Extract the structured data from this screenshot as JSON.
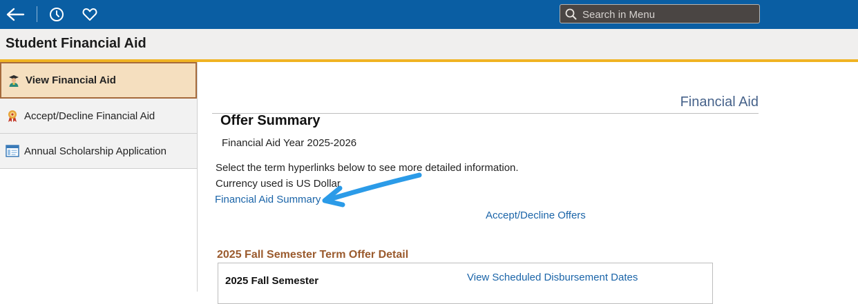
{
  "header": {
    "back_icon": "back-arrow-icon",
    "history_icon": "history-icon",
    "favorites_icon": "heart-icon",
    "search_placeholder": "Search in Menu",
    "search_icon": "search-icon"
  },
  "page_title": "Student Financial Aid",
  "sidebar": {
    "items": [
      {
        "label": "View Financial Aid",
        "icon": "student-graduate-icon",
        "active": true
      },
      {
        "label": "Accept/Decline Financial Aid",
        "icon": "award-ribbon-icon",
        "active": false
      },
      {
        "label": "Annual Scholarship Application",
        "icon": "application-window-icon",
        "active": false
      }
    ]
  },
  "main": {
    "section_title": "Financial Aid",
    "offer_summary_heading": "Offer Summary",
    "aid_year": "Financial Aid Year 2025-2026",
    "instruction": "Select the term hyperlinks below to see more detailed information.",
    "currency": "Currency used is US Dollar",
    "financial_aid_summary_link": "Financial Aid Summary",
    "accept_decline_link": "Accept/Decline Offers",
    "term_offer_heading": "2025 Fall Semester Term Offer Detail",
    "term": {
      "name": "2025 Fall Semester",
      "disbursement_link": "View Scheduled Disbursement Dates"
    }
  },
  "colors": {
    "banner": "#0a5ea3",
    "accent": "#f0b323",
    "link": "#1a64a8",
    "term_heading": "#9a5a2d",
    "annotation_arrow": "#2b9be8"
  }
}
